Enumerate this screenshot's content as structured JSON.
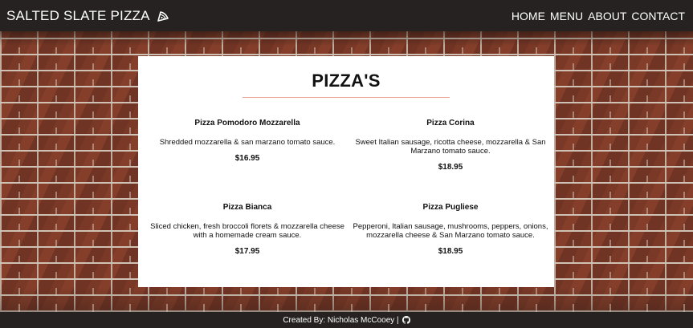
{
  "navbar": {
    "brand": "SALTED SLATE PIZZA",
    "brand_icon": "pizza-slice-icon",
    "links": [
      "HOME",
      "MENU",
      "ABOUT",
      "CONTACT"
    ]
  },
  "menu": {
    "title": "PIZZA'S",
    "items": [
      {
        "name": "Pizza Pomodoro Mozzarella",
        "description": "Shredded mozzarella & san marzano tomato sauce.",
        "price": "$16.95"
      },
      {
        "name": "Pizza Corina",
        "description": "Sweet Italian sausage, ricotta cheese, mozzarella & San Marzano tomato sauce.",
        "price": "$18.95"
      },
      {
        "name": "Pizza Bianca",
        "description": "Sliced chicken, fresh broccoli florets & mozzarella cheese with a homemade cream sauce.",
        "price": "$17.95"
      },
      {
        "name": "Pizza Pugliese",
        "description": "Pepperoni, Italian sausage, mushrooms, peppers, onions, mozzarella cheese & San Marzano tomato sauce.",
        "price": "$18.95"
      }
    ]
  },
  "footer": {
    "credit": "Created By: Nicholas McCooey |",
    "icon": "github-icon"
  },
  "colors": {
    "nav_bg": "#252221",
    "rule": "#e8a8a0",
    "card_bg": "#ffffff"
  }
}
